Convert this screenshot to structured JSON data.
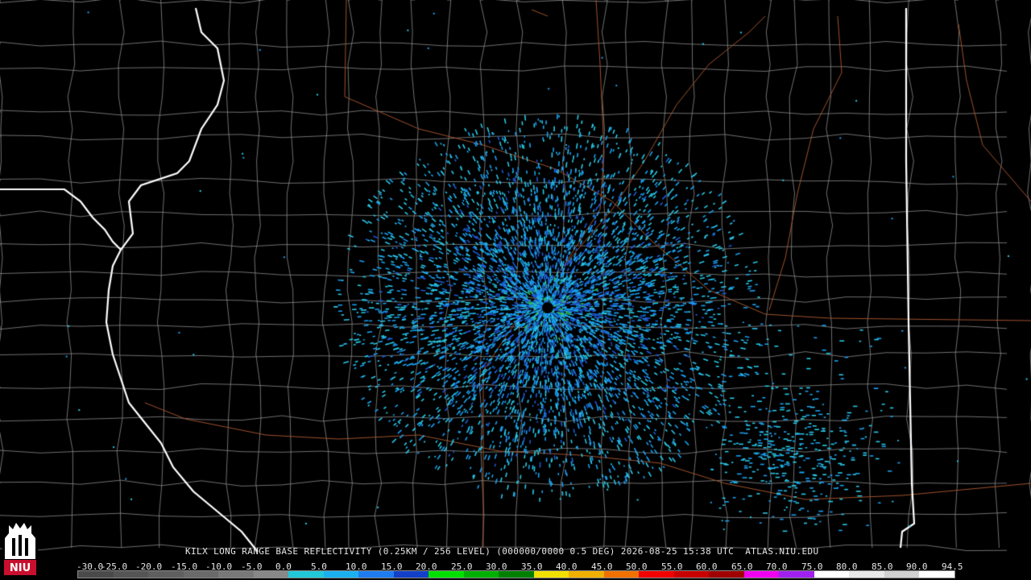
{
  "caption": {
    "text": "KILX LONG RANGE BASE REFLECTIVITY (0.25KM / 256 LEVEL) (000000/0000 0.5 DEG) 2026-08-25 15:38 UTC  ATLAS.NIU.EDU"
  },
  "logo": {
    "text": "NIU",
    "color": "#c8102e"
  },
  "scale": {
    "ticks": [
      "-30.0",
      "-25.0",
      "-20.0",
      "-15.0",
      "-10.0",
      "-5.0",
      "0.0",
      "5.0",
      "10.0",
      "15.0",
      "20.0",
      "25.0",
      "30.0",
      "35.0",
      "40.0",
      "45.0",
      "50.0",
      "55.0",
      "60.0",
      "65.0",
      "70.0",
      "75.0",
      "80.0",
      "85.0",
      "90.0",
      "94.5"
    ],
    "colors": [
      "#4a4a4a",
      "#555555",
      "#5f5f5f",
      "#6a6a6a",
      "#787878",
      "#888888",
      "#20c8d8",
      "#1ab0f0",
      "#1e7cf0",
      "#1340c8",
      "#00e000",
      "#00b000",
      "#008000",
      "#f0e000",
      "#f0b000",
      "#f07000",
      "#f00000",
      "#c80000",
      "#a00000",
      "#f000f0",
      "#a020f0",
      "#ffffff",
      "#e8e8e8",
      "#d0d0d0",
      "#ffffff"
    ]
  },
  "map": {
    "radar_site": "KILX",
    "colors": {
      "county_lines": "#8c8c8c",
      "state_lines": "#ffffff",
      "highways": "#a0522d",
      "radar_light": "#28c8e6",
      "radar_mid": "#1aa0f0",
      "radar_dark": "#1e5ad2",
      "radar_green": "#32c850",
      "radar_yellow": "#e6e61e"
    }
  }
}
